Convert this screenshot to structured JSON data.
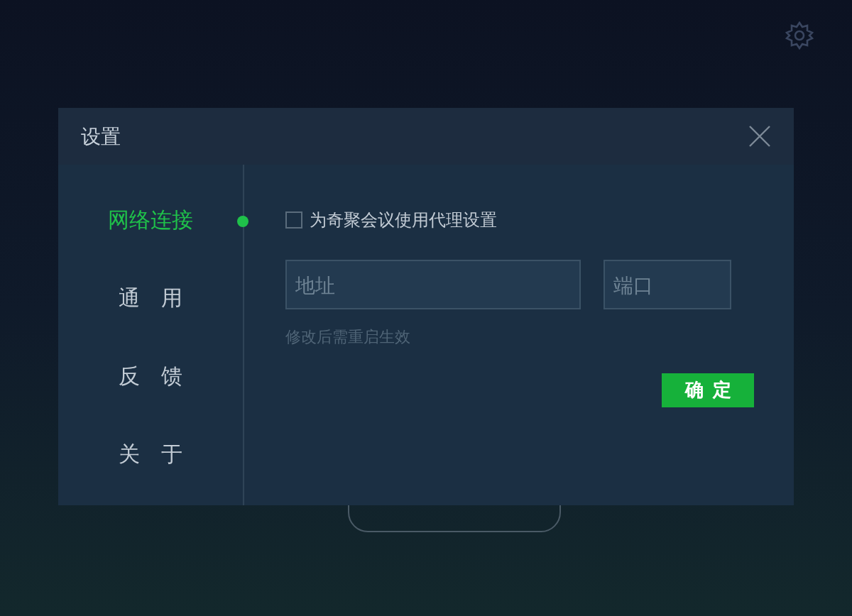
{
  "dialog": {
    "title": "设置"
  },
  "nav": [
    {
      "label": "网络连接",
      "selected": true
    },
    {
      "label": "通用",
      "selected": false
    },
    {
      "label": "反馈",
      "selected": false
    },
    {
      "label": "关于",
      "selected": false
    }
  ],
  "proxy": {
    "label": "为奇聚会议使用代理设置",
    "checked": false
  },
  "address": {
    "placeholder": "地址"
  },
  "port": {
    "placeholder": "端口"
  },
  "hint": "修改后需重启生效",
  "confirm": "确定"
}
